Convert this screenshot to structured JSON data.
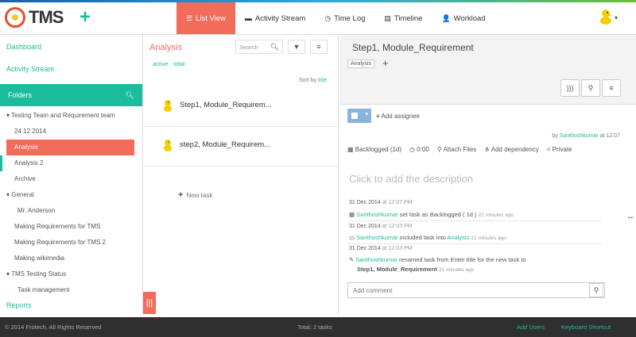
{
  "app": {
    "logo_text": "TMS"
  },
  "nav": {
    "items": [
      {
        "label": "List View",
        "icon": "list-icon",
        "active": true
      },
      {
        "label": "Activity Stream",
        "icon": "comment-icon"
      },
      {
        "label": "Time Log",
        "icon": "clock-icon"
      },
      {
        "label": "Timeline",
        "icon": "timeline-icon"
      },
      {
        "label": "Workload",
        "icon": "user-icon"
      }
    ]
  },
  "sidebar": {
    "links": [
      "Dashboard",
      "Activity Stream"
    ],
    "folders_label": "Folders",
    "tree": [
      {
        "label": "Testing Team and Requirement team",
        "caret": "▾"
      },
      {
        "label": "24 12 2014"
      },
      {
        "label": "Analysis",
        "selected": true
      },
      {
        "label": "Analysis 2"
      },
      {
        "label": "Archive"
      },
      {
        "label": "General",
        "caret": "▾"
      },
      {
        "label": "Mr. Anderson"
      },
      {
        "label": "Making Requirements for TMS"
      },
      {
        "label": "Making Requirements for TMS 2"
      },
      {
        "label": "Making wikimedia"
      },
      {
        "label": "TMS Testing Status",
        "caret": "▾"
      },
      {
        "label": "Task management"
      }
    ],
    "reports_label": "Reports"
  },
  "middle": {
    "title": "Analysis",
    "search_placeholder": "Search",
    "filter_active": "active",
    "filter_total": "total",
    "sort_label": "Sort by",
    "sort_value": "title",
    "tasks": [
      "Step1, Module_Requirem...",
      "step2, Module_Requirem..."
    ],
    "new_task": "New task"
  },
  "detail": {
    "title": "Step1, Module_Requirement",
    "tag": "Analysis",
    "add_assignee": "Add assignee",
    "by_prefix": "by",
    "by_user": "Santhoshkumar",
    "by_time": "at 12:07",
    "props": {
      "status": "Backlogged (1d)",
      "time": "0:00",
      "attach": "Attach Files",
      "dependency": "Add dependency",
      "privacy": "Private"
    },
    "description_placeholder": "Click to add the description",
    "activity": [
      {
        "date": "31 Dec 2014",
        "time": "at 12:07 PM",
        "user": "Santhoshkumar",
        "text": "set task as Backlogged ( 1d )",
        "ago": "21 minutes ago"
      },
      {
        "date": "31 Dec 2014",
        "time": "at 12:03 PM",
        "user": "Santhoshkumar",
        "text": "included task into",
        "link": "Analysis",
        "ago": "21 minutes ago"
      },
      {
        "date": "31 Dec 2014",
        "time": "at 12:03 PM",
        "user": "Santhoshkumar",
        "text": "renamed task from Enter title for the new task to",
        "task": "Step1, Module_Requirement",
        "ago": "21 minutes ago"
      }
    ],
    "comment_placeholder": "Add comment"
  },
  "footer": {
    "copyright": "© 2014 Frotech, All Rights Reserved",
    "total": "Total: 2 tasks",
    "add_users": "Add Users",
    "keyboard": "Keyboard Shortcut"
  },
  "colors": {
    "accent": "#1abc9c",
    "active": "#f26b5b",
    "footer": "#2f2f2f"
  }
}
